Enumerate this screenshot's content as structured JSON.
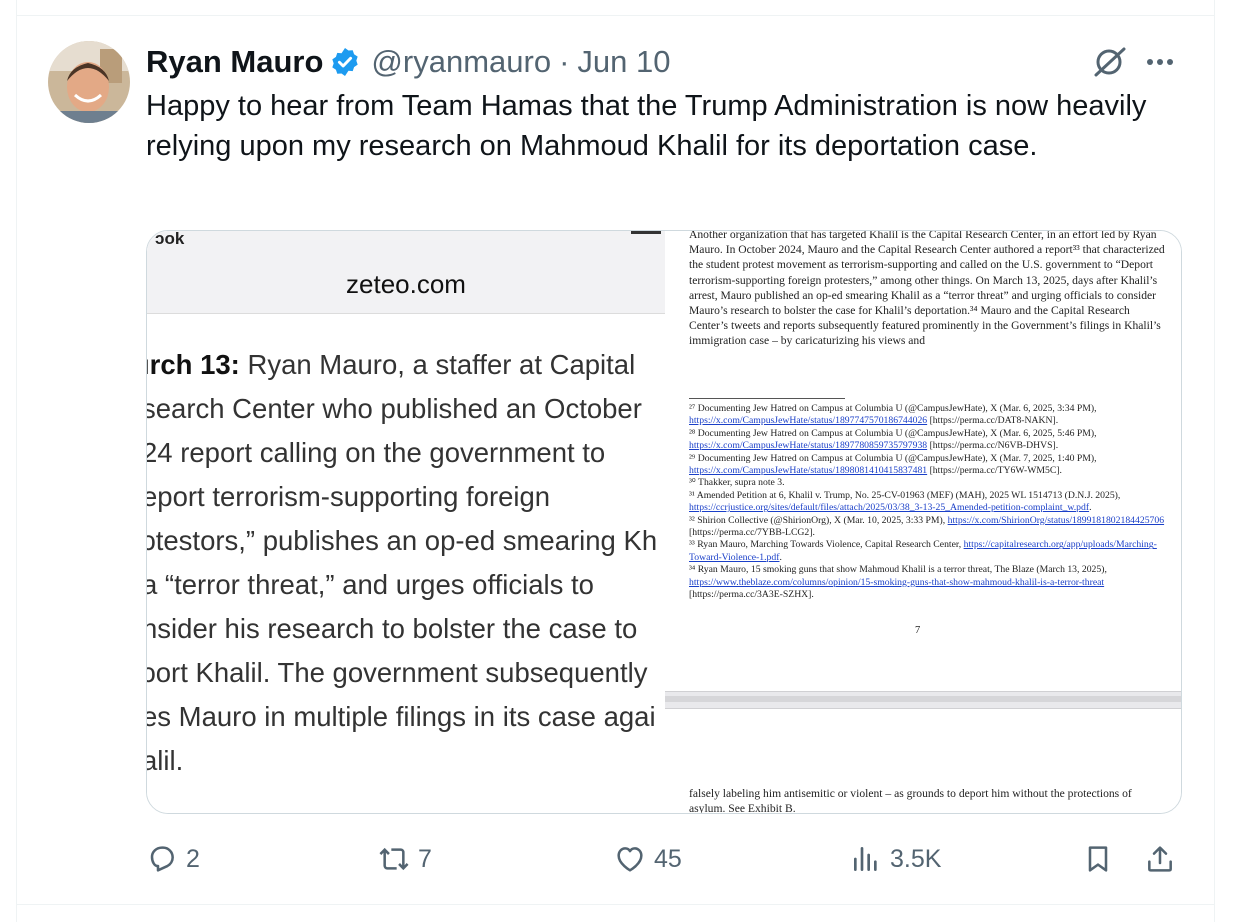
{
  "tweet": {
    "author_name": "Ryan Mauro",
    "handle": "@ryanmauro",
    "separator": "·",
    "date": "Jun 10",
    "text": "Happy to hear from Team Hamas that the Trump Administration is now heavily relying upon my research on Mahmoud Khalil for its deportation case."
  },
  "media": {
    "left_image": {
      "status_fragment": "ɔok",
      "url_bar": "zeteo.com",
      "article_bold": "ırch 13:",
      "article_lines": [
        " Ryan Mauro, a staffer at Capital",
        "search Center who published an October",
        "24 report calling on the government to",
        "eport terrorism-supporting foreign",
        "ɔtestors,” publishes an op-ed smearing Kh",
        "a “terror threat,” and urges officials to",
        "nsider his research to bolster the case to",
        "ɔort Khalil. The government subsequently",
        "es Mauro in multiple filings in its case agai",
        "alil."
      ]
    },
    "right_image": {
      "paragraph": "Another organization that has targeted Khalil is the Capital Research Center, in an effort led by Ryan Mauro. In October 2024, Mauro and the Capital Research Center authored a report³³ that characterized the student protest movement as terrorism-supporting and called on the U.S. government to “Deport terrorism-supporting foreign protesters,” among other things. On March 13, 2025, days after Khalil’s arrest, Mauro published an op-ed smearing Khalil as a “terror threat” and urging officials to consider Mauro’s research to bolster the case for Khalil’s deportation.³⁴ Mauro and the Capital Research Center’s tweets and reports subsequently featured prominently in the Government’s filings in Khalil’s immigration case – by caricaturizing his views and",
      "footnotes": [
        {
          "text": "²⁷ Documenting Jew Hatred on Campus at Columbia U (@CampusJewHate), X (Mar. 6, 2025, 3:34 PM),",
          "link": "https://x.com/CampusJewHate/status/1897747570186744026",
          "tail": " [https://perma.cc/DAT8-NAKN]."
        },
        {
          "text": "²⁸ Documenting Jew Hatred on Campus at Columbia U (@CampusJewHate), X (Mar. 6, 2025, 5:46 PM),",
          "link": "https://x.com/CampusJewHate/status/1897780859735797938",
          "tail": " [https://perma.cc/N6VB-DHVS]."
        },
        {
          "text": "²⁹ Documenting Jew Hatred on Campus at Columbia U (@CampusJewHate), X (Mar. 7, 2025, 1:40 PM),",
          "link": "https://x.com/CampusJewHate/status/1898081410415837481",
          "tail": " [https://perma.cc/TY6W-WM5C]."
        },
        {
          "text": "³⁰ Thakker, supra note 3.",
          "link": "",
          "tail": ""
        },
        {
          "text": "³¹ Amended Petition at 6, Khalil v. Trump, No. 25-CV-01963 (MEF) (MAH), 2025 WL 1514713 (D.N.J. 2025),",
          "link": "https://ccrjustice.org/sites/default/files/attach/2025/03/38_3-13-25_Amended-petition-complaint_w.pdf",
          "tail": "."
        },
        {
          "text": "³² Shirion Collective (@ShirionOrg), X (Mar. 10, 2025, 3:33 PM),",
          "link": "https://x.com/ShirionOrg/status/1899181802184425706",
          "tail": " [https://perma.cc/7YBB-LCG2]."
        },
        {
          "text": "³³ Ryan Mauro, Marching Towards Violence, Capital Research Center,",
          "link": "https://capitalresearch.org/app/uploads/Marching-Toward-Violence-1.pdf",
          "tail": "."
        },
        {
          "text": "³⁴ Ryan Mauro, 15 smoking guns that show Mahmoud Khalil is a terror threat, The Blaze (March 13, 2025),",
          "link": "https://www.theblaze.com/columns/opinion/15-smoking-guns-that-show-mahmoud-khalil-is-a-terror-threat",
          "tail": " [https://perma.cc/3A3E-SZHX]."
        }
      ],
      "page_number": "7",
      "bottom_text": "falsely labeling him antisemitic or violent – as grounds to deport him without the protections of asylum. See Exhibit B."
    }
  },
  "actions": {
    "replies": "2",
    "reposts": "7",
    "likes": "45",
    "views": "3.5K"
  },
  "colors": {
    "verified_blue": "#1d9bf0",
    "muted_text": "#536471",
    "primary_text": "#0f1419",
    "border": "#cfd9de",
    "link": "#1a3fc8"
  },
  "icons": [
    "verified-badge-icon",
    "grok-icon",
    "more-icon",
    "reply-icon",
    "repost-icon",
    "like-icon",
    "views-icon",
    "bookmark-icon",
    "share-icon"
  ]
}
